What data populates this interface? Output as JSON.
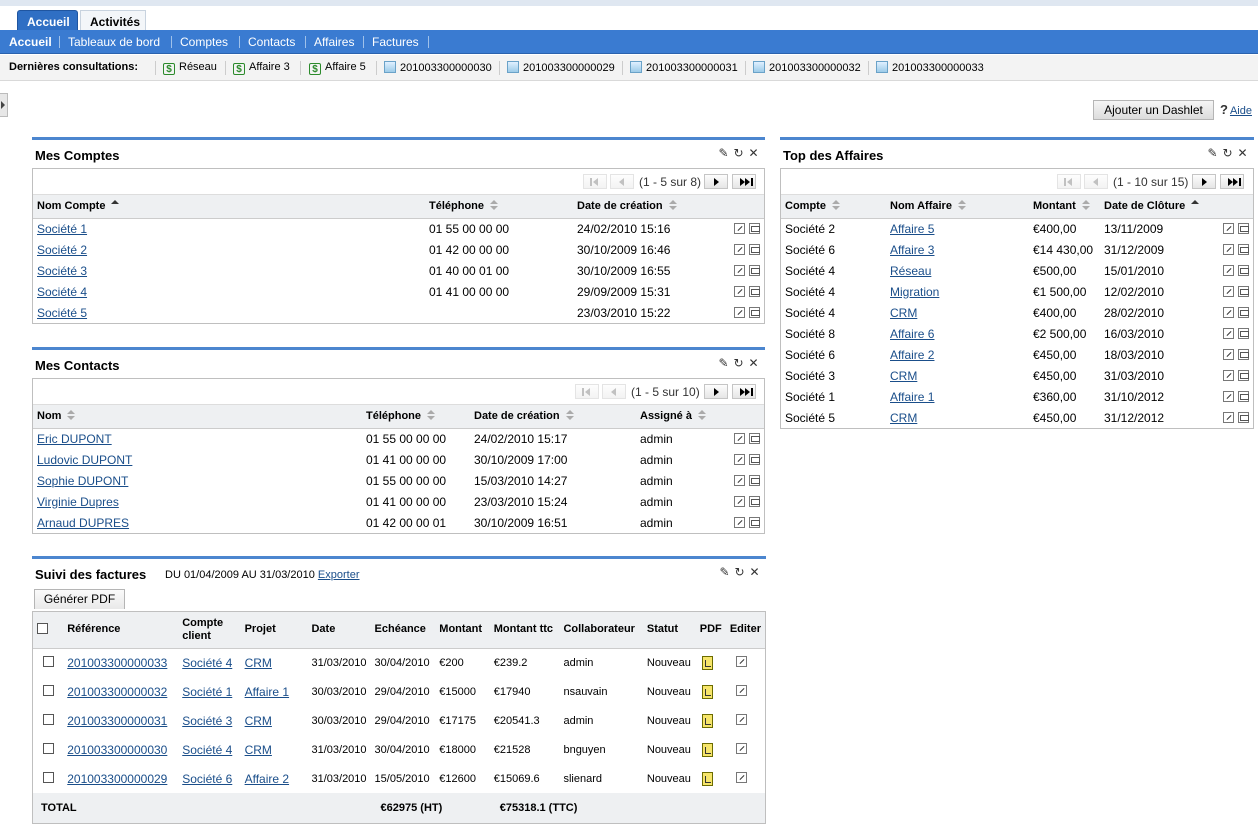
{
  "top_tabs": [
    "Accueil",
    "Activités"
  ],
  "nav": [
    "Accueil",
    "Tableaux de bord",
    "Comptes",
    "Contacts",
    "Affaires",
    "Factures"
  ],
  "recent": {
    "label": "Dernières consultations:",
    "items": [
      {
        "label": "Réseau",
        "icon": "dollar-icon"
      },
      {
        "label": "Affaire 3",
        "icon": "dollar-icon"
      },
      {
        "label": "Affaire 5",
        "icon": "dollar-icon"
      },
      {
        "label": "201003300000030",
        "icon": "invoice-icon"
      },
      {
        "label": "201003300000029",
        "icon": "invoice-icon"
      },
      {
        "label": "201003300000031",
        "icon": "invoice-icon"
      },
      {
        "label": "201003300000032",
        "icon": "invoice-icon"
      },
      {
        "label": "201003300000033",
        "icon": "invoice-icon"
      }
    ]
  },
  "toolbar": {
    "add_dashlet": "Ajouter un Dashlet",
    "help": "Aide",
    "help_mark": "?"
  },
  "comptes": {
    "title": "Mes Comptes",
    "pager": "(1 - 5 sur 8)",
    "headers": [
      "Nom Compte",
      "Téléphone",
      "Date de création"
    ],
    "rows": [
      [
        "Société 1",
        "01 55 00 00 00",
        "24/02/2010 15:16"
      ],
      [
        "Société 2",
        "01 42 00 00 00",
        "30/10/2009 16:46"
      ],
      [
        "Société 3",
        "01 40 00 01 00",
        "30/10/2009 16:55"
      ],
      [
        "Société 4",
        "01 41 00 00 00",
        "29/09/2009 15:31"
      ],
      [
        "Société 5",
        "",
        "23/03/2010 15:22"
      ]
    ]
  },
  "contacts": {
    "title": "Mes Contacts",
    "pager": "(1 - 5 sur 10)",
    "headers": [
      "Nom",
      "Téléphone",
      "Date de création",
      "Assigné à"
    ],
    "rows": [
      [
        "Eric DUPONT",
        "01 55 00 00 00",
        "24/02/2010 15:17",
        "admin"
      ],
      [
        "Ludovic DUPONT",
        "01 41 00 00 00",
        "30/10/2009 17:00",
        "admin"
      ],
      [
        "Sophie DUPONT",
        "01 55 00 00 00",
        "15/03/2010 14:27",
        "admin"
      ],
      [
        "Virginie Dupres",
        "01 41 00 00 00",
        "23/03/2010 15:24",
        "admin"
      ],
      [
        "Arnaud DUPRES",
        "01 42 00 00 01",
        "30/10/2009 16:51",
        "admin"
      ]
    ]
  },
  "affaires": {
    "title": "Top des Affaires",
    "pager": "(1 - 10 sur 15)",
    "headers": [
      "Compte",
      "Nom Affaire",
      "Montant",
      "Date de Clôture"
    ],
    "rows": [
      [
        "Société 2",
        "Affaire 5",
        "€400,00",
        "13/11/2009"
      ],
      [
        "Société 6",
        "Affaire 3",
        "€14 430,00",
        "31/12/2009"
      ],
      [
        "Société 4",
        "Réseau",
        "€500,00",
        "15/01/2010"
      ],
      [
        "Société 4",
        "Migration",
        "€1 500,00",
        "12/02/2010"
      ],
      [
        "Société 4",
        "CRM",
        "€400,00",
        "28/02/2010"
      ],
      [
        "Société 8",
        "Affaire 6",
        "€2 500,00",
        "16/03/2010"
      ],
      [
        "Société 6",
        "Affaire 2",
        "€450,00",
        "18/03/2010"
      ],
      [
        "Société 3",
        "CRM",
        "€450,00",
        "31/03/2010"
      ],
      [
        "Société 1",
        "Affaire 1",
        "€360,00",
        "31/10/2012"
      ],
      [
        "Société 5",
        "CRM",
        "€450,00",
        "31/12/2012"
      ]
    ]
  },
  "factures": {
    "title": "Suivi des factures",
    "period": "DU 01/04/2009 AU 31/03/2010",
    "export": "Exporter",
    "pdf_button": "Générer PDF",
    "headers": [
      "Référence",
      "Compte client",
      "Projet",
      "Date",
      "Echéance",
      "Montant",
      "Montant ttc",
      "Collaborateur",
      "Statut",
      "PDF",
      "Editer"
    ],
    "rows": [
      [
        "201003300000033",
        "Société 4",
        "CRM",
        "31/03/2010",
        "30/04/2010",
        "€200",
        "€239.2",
        "admin",
        "Nouveau"
      ],
      [
        "201003300000032",
        "Société 1",
        "Affaire 1",
        "30/03/2010",
        "29/04/2010",
        "€15000",
        "€17940",
        "nsauvain",
        "Nouveau"
      ],
      [
        "201003300000031",
        "Société 3",
        "CRM",
        "30/03/2010",
        "29/04/2010",
        "€17175",
        "€20541.3",
        "admin",
        "Nouveau"
      ],
      [
        "201003300000030",
        "Société 4",
        "CRM",
        "31/03/2010",
        "30/04/2010",
        "€18000",
        "€21528",
        "bnguyen",
        "Nouveau"
      ],
      [
        "201003300000029",
        "Société 6",
        "Affaire 2",
        "31/03/2010",
        "15/05/2010",
        "€12600",
        "€15069.6",
        "slienard",
        "Nouveau"
      ]
    ],
    "total_label": "TOTAL",
    "total_ht": "€62975 (HT)",
    "total_ttc": "€75318.1 (TTC)"
  }
}
